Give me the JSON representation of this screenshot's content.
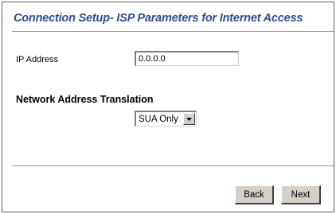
{
  "page": {
    "title": "Connection Setup- ISP Parameters for Internet Access"
  },
  "ip_address": {
    "label": "IP Address",
    "value": "0.0.0.0"
  },
  "nat": {
    "label": "Network Address Translation",
    "selected": "SUA Only"
  },
  "buttons": {
    "back": "Back",
    "next": "Next"
  },
  "colors": {
    "title": "#2f4f8f",
    "button_face": "#d4d0c8",
    "border": "#5a5a5a"
  },
  "icons": {
    "dropdown": "chevron-down-icon"
  }
}
